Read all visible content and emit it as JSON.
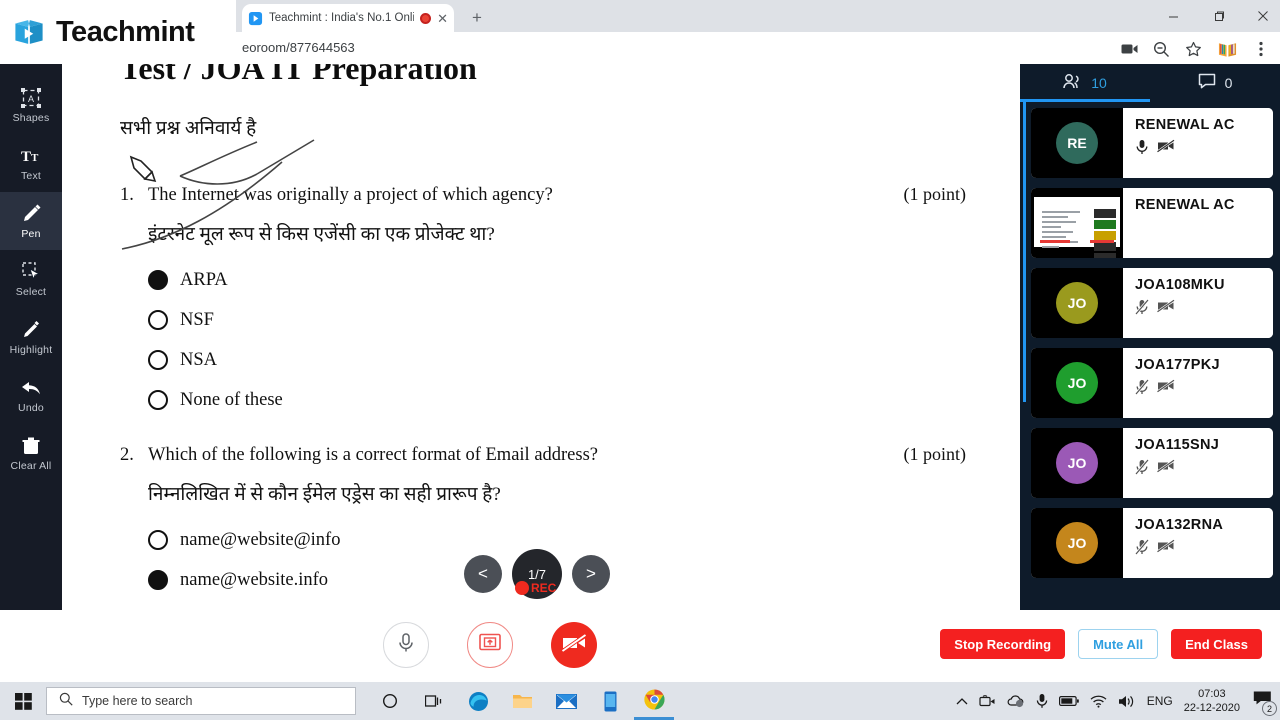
{
  "browser": {
    "brand_name": "Teachmint",
    "tab": {
      "title": "Teachmint : India's No.1 Onli",
      "close_label": "✕",
      "recording_indicator": "recording-dot"
    },
    "new_tab_label": "+",
    "url": "eoroom/877644563",
    "toolbar_icons": [
      "cast-icon",
      "zoom-out-icon",
      "bookmark-star-icon",
      "extension-icon",
      "chrome-menu-icon"
    ],
    "window_controls": [
      "minimize",
      "maximize",
      "close"
    ]
  },
  "toolrail": {
    "items": [
      {
        "label": "Shapes",
        "icon": "shapes-icon",
        "active": false
      },
      {
        "label": "Text",
        "icon": "text-icon",
        "active": false
      },
      {
        "label": "Pen",
        "icon": "pen-icon",
        "active": true
      },
      {
        "label": "Select",
        "icon": "select-icon",
        "active": false
      },
      {
        "label": "Highlight",
        "icon": "highlight-icon",
        "active": false
      },
      {
        "label": "Undo",
        "icon": "undo-icon",
        "active": false
      },
      {
        "label": "Clear All",
        "icon": "trash-icon",
        "active": false
      }
    ]
  },
  "document": {
    "title": "Test / JOA IT Preparation",
    "instruction": "सभी प्रश्न अनिवार्य है",
    "questions": [
      {
        "number": "1.",
        "text_en": "The Internet was originally a project of which agency?",
        "text_hi": "इंटरनेट मूल रूप से किस एजेंसी का एक प्रोजेक्ट था?",
        "points": "(1 point)",
        "options": [
          {
            "label": "ARPA",
            "selected": true
          },
          {
            "label": "NSF",
            "selected": false
          },
          {
            "label": "NSA",
            "selected": false
          },
          {
            "label": "None of these",
            "selected": false
          }
        ]
      },
      {
        "number": "2.",
        "text_en": "Which of the following is a correct format of Email address?",
        "text_hi": "निम्नलिखित में से कौन ईमेल एड्रेस का सही प्रारूप है?",
        "points": "(1 point)",
        "options": [
          {
            "label": "name@website@info",
            "selected": false
          },
          {
            "label": "name@website.info",
            "selected": true
          }
        ]
      }
    ],
    "nav": {
      "prev_label": "<",
      "next_label": ">",
      "page_indicator": "1/7",
      "rec_label": "REC"
    }
  },
  "panel": {
    "tabs": [
      {
        "icon": "people-icon",
        "count": "10",
        "active": true
      },
      {
        "icon": "chat-icon",
        "count": "0",
        "active": false
      }
    ],
    "participants": [
      {
        "name": "RENEWAL AC",
        "initials": "RE",
        "color": "#2f6a5c",
        "mic": "mic-on",
        "cam": "cam-off",
        "screen_share": false
      },
      {
        "name": "RENEWAL AC",
        "initials": "",
        "color": "#000000",
        "mic": "",
        "cam": "",
        "screen_share": true
      },
      {
        "name": "JOA108MKU",
        "initials": "JO",
        "color": "#9a9a1e",
        "mic": "mic-off",
        "cam": "cam-off",
        "screen_share": false
      },
      {
        "name": "JOA177PKJ",
        "initials": "JO",
        "color": "#1f9e2e",
        "mic": "mic-off",
        "cam": "cam-off",
        "screen_share": false
      },
      {
        "name": "JOA115SNJ",
        "initials": "JO",
        "color": "#9b59b6",
        "mic": "mic-off",
        "cam": "cam-off",
        "screen_share": false
      },
      {
        "name": "JOA132RNA",
        "initials": "JO",
        "color": "#c4861c",
        "mic": "mic-off",
        "cam": "cam-off",
        "screen_share": false
      }
    ]
  },
  "controls": {
    "mic": "mic-icon",
    "share": "screen-share-icon",
    "video": "video-off-icon",
    "stop_recording": "Stop Recording",
    "mute_all": "Mute All",
    "end_class": "End Class",
    "accent_danger": "#f42020",
    "accent_blue": "#2f9fe0"
  },
  "taskbar": {
    "search_placeholder": "Type here to search",
    "apps": [
      "cortana-icon",
      "task-view-icon",
      "edge-icon",
      "file-explorer-icon",
      "mail-icon",
      "phone-icon",
      "chrome-icon"
    ],
    "tray": {
      "language": "ENG",
      "time": "07:03",
      "date": "22-12-2020",
      "notification_count": "2"
    }
  }
}
